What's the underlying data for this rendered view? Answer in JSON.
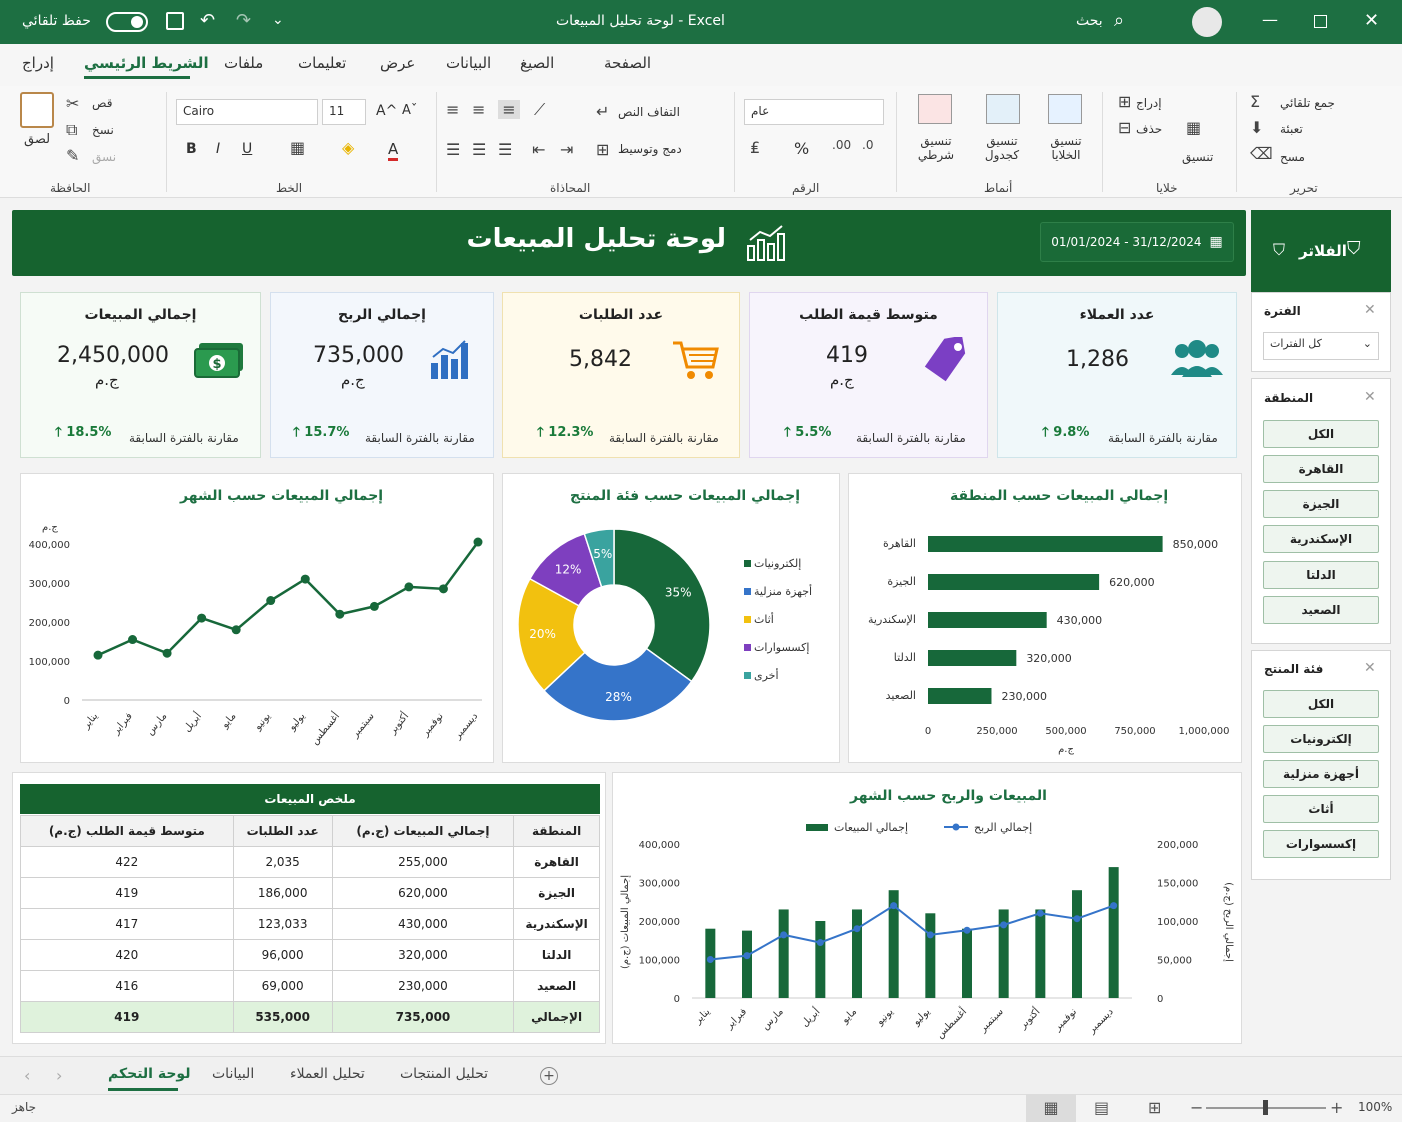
{
  "titlebar": {
    "autosave_label": "حفظ تلقائي",
    "title": "لوحة تحليل المبيعات - Excel",
    "search_label": "بحث"
  },
  "ribbon_tabs": [
    "الصفحة",
    "الصيغ",
    "البيانات",
    "عرض",
    "تعليمات",
    "ملفات",
    "الشريط الرئيسي",
    "إدراج"
  ],
  "ribbon_tabs_active": "الشريط الرئيسي",
  "ribbon": {
    "clipboard": {
      "paste": "لصق",
      "cut": "قص",
      "copy": "نسخ",
      "format_painter": "نسق",
      "group": "الحافظة"
    },
    "font": {
      "name": "Cairo",
      "size": "11",
      "bold": "B",
      "italic": "I",
      "underline": "U",
      "grow": "A^",
      "shrink": "Aˇ",
      "color": "A",
      "group": "الخط"
    },
    "alignment": {
      "wrap": "التفاف النص",
      "merge": "دمج وتوسيط",
      "group": "المحاذاة"
    },
    "number": {
      "format": "عام",
      "percent": "%",
      "group": "الرقم"
    },
    "styles": {
      "conditional": "تنسيق شرطي",
      "table": "تنسيق كجدول",
      "cell": "تنسيق الخلايا",
      "group": "أنماط"
    },
    "cells": {
      "insert": "إدراج",
      "delete": "حذف",
      "format": "تنسيق",
      "group": "خلايا"
    },
    "editing": {
      "autosum": "جمع تلقائي",
      "fill": "تعبئة",
      "clear": "مسح",
      "group": "تحرير"
    }
  },
  "dashboard": {
    "title": "لوحة تحليل المبيعات",
    "date_range": "01/01/2024 - 31/12/2024"
  },
  "kpis": [
    {
      "title": "إجمالي المبيعات",
      "value": "2,450,000",
      "unit": "ج.م",
      "compare": "مقارنة بالفترة السابقة",
      "pct": "18.5%"
    },
    {
      "title": "إجمالي الربح",
      "value": "735,000",
      "unit": "ج.م",
      "compare": "مقارنة بالفترة السابقة",
      "pct": "15.7%"
    },
    {
      "title": "عدد الطلبات",
      "value": "5,842",
      "unit": "",
      "compare": "مقارنة بالفترة السابقة",
      "pct": "12.3%"
    },
    {
      "title": "متوسط قيمة الطلب",
      "value": "419",
      "unit": "ج.م",
      "compare": "مقارنة بالفترة السابقة",
      "pct": "5.5%"
    },
    {
      "title": "عدد العملاء",
      "value": "1,286",
      "unit": "",
      "compare": "مقارنة بالفترة السابقة",
      "pct": "9.8%"
    }
  ],
  "chart_data": [
    {
      "type": "line",
      "title": "إجمالي المبيعات حسب الشهر",
      "ylabel": "ج.م",
      "categories": [
        "يناير",
        "فبراير",
        "مارس",
        "أبريل",
        "مايو",
        "يونيو",
        "يوليو",
        "أغسطس",
        "سبتمبر",
        "أكتوبر",
        "نوفمبر",
        "ديسمبر"
      ],
      "values": [
        115000,
        155000,
        120000,
        210000,
        180000,
        255000,
        310000,
        220000,
        240000,
        290000,
        285000,
        405000
      ],
      "ylim": [
        0,
        400000
      ],
      "yticks": [
        "0",
        "100,000",
        "200,000",
        "300,000",
        "400,000"
      ]
    },
    {
      "type": "pie",
      "title": "إجمالي المبيعات حسب فئة المنتج",
      "categories": [
        "إلكترونيات",
        "أجهزة منزلية",
        "أثاث",
        "إكسسوارات",
        "أخرى"
      ],
      "values": [
        35,
        28,
        20,
        12,
        5
      ],
      "labels": [
        "35%",
        "28%",
        "20%",
        "12%",
        "5%"
      ],
      "colors": [
        "#17683a",
        "#3574c9",
        "#f2c10f",
        "#7e3fbf",
        "#3aa39f"
      ]
    },
    {
      "type": "bar",
      "title": "إجمالي المبيعات حسب المنطقة",
      "xlabel": "ج.م",
      "categories": [
        "القاهرة",
        "الجيزة",
        "الإسكندرية",
        "الدلتا",
        "الصعيد"
      ],
      "values": [
        850000,
        620000,
        430000,
        320000,
        230000
      ],
      "value_labels": [
        "850,000",
        "620,000",
        "430,000",
        "320,000",
        "230,000"
      ],
      "xlim": [
        0,
        1000000
      ],
      "xticks": [
        "0",
        "250,000",
        "500,000",
        "750,000",
        "1,000,000"
      ]
    },
    {
      "type": "bar",
      "title": "المبيعات والربح حسب الشهر",
      "categories": [
        "يناير",
        "فبراير",
        "مارس",
        "أبريل",
        "مايو",
        "يونيو",
        "يوليو",
        "أغسطس",
        "سبتمبر",
        "أكتوبر",
        "نوفمبر",
        "ديسمبر"
      ],
      "series": [
        {
          "name": "إجمالي المبيعات",
          "values": [
            180000,
            175000,
            230000,
            200000,
            230000,
            280000,
            220000,
            180000,
            230000,
            230000,
            280000,
            340000
          ],
          "axis": "left",
          "kind": "bar"
        },
        {
          "name": "إجمالي الربح",
          "values": [
            50000,
            55000,
            82000,
            72000,
            90000,
            120000,
            82000,
            88000,
            95000,
            110000,
            103000,
            120000
          ],
          "axis": "right",
          "kind": "line"
        }
      ],
      "ylim_left": [
        0,
        400000
      ],
      "ylim_right": [
        0,
        200000
      ],
      "ylabel_left": "إجمالي المبيعات (ج.م)",
      "ylabel_right": "إجمالي الربح (ج.م)",
      "yticks_left": [
        "0",
        "100,000",
        "200,000",
        "300,000",
        "400,000"
      ],
      "yticks_right": [
        "0",
        "50,000",
        "100,000",
        "150,000",
        "200,000"
      ]
    }
  ],
  "summary_table": {
    "title": "ملخص المبيعات",
    "headers": [
      "المنطقة",
      "إجمالي المبيعات (ج.م)",
      "عدد الطلبات",
      "متوسط قيمة الطلب (ج.م)"
    ],
    "rows": [
      [
        "القاهرة",
        "255,000",
        "2,035",
        "422"
      ],
      [
        "الجيزة",
        "620,000",
        "186,000",
        "419"
      ],
      [
        "الإسكندرية",
        "430,000",
        "123,033",
        "417"
      ],
      [
        "الدلتا",
        "320,000",
        "96,000",
        "420"
      ],
      [
        "الصعيد",
        "230,000",
        "69,000",
        "416"
      ]
    ],
    "total": [
      "الإجمالي",
      "735,000",
      "535,000",
      "419"
    ]
  },
  "filters": {
    "title": "الفلاتر",
    "period_label": "الفترة",
    "period_value": "كل الفترات",
    "region_label": "المنطقة",
    "regions": [
      "الكل",
      "القاهرة",
      "الجيزة",
      "الإسكندرية",
      "الدلتا",
      "الصعيد"
    ],
    "category_label": "فئة المنتج",
    "categories": [
      "الكل",
      "إلكترونيات",
      "أجهزة منزلية",
      "أثاث",
      "إكسسوارات"
    ]
  },
  "sheet_tabs": [
    "لوحة التحكم",
    "البيانات",
    "تحليل العملاء",
    "تحليل المنتجات"
  ],
  "status": {
    "ready": "جاهز",
    "zoom": "100%"
  },
  "colors": {
    "brand": "#1d6f42",
    "dark": "#16632f",
    "accent_up": "#1a7a3a"
  }
}
